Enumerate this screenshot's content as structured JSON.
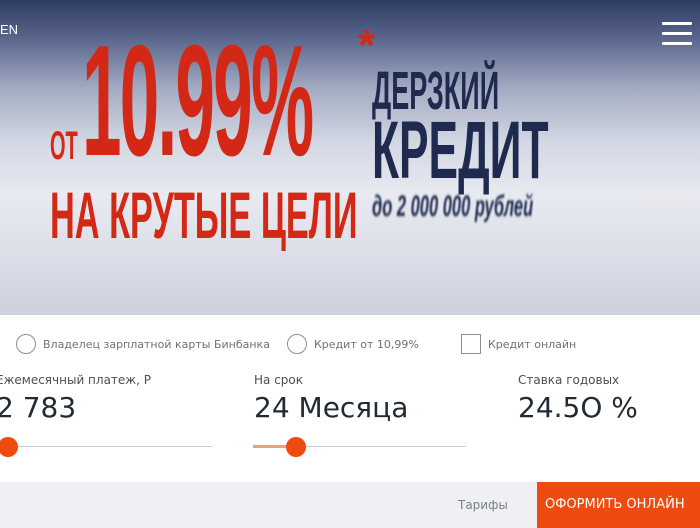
{
  "header": {
    "language": "EN"
  },
  "banner": {
    "rate_prefix": "ОТ",
    "rate_value": "10.99%",
    "rate_asterisk": "*",
    "goal_text": "НА КРУТЫЕ ЦЕЛИ",
    "brand_line1": "ДЕРЗКИЙ",
    "brand_line2": "КРЕДИТ",
    "amount_text": "до 2 000 000 рублей"
  },
  "options": [
    {
      "label": "Владелец зарплатной карты Бинбанка",
      "type": "radio",
      "checked": false
    },
    {
      "label": "Кредит от 10,99%",
      "type": "radio",
      "checked": false
    },
    {
      "label": "Кредит онлайн",
      "type": "checkbox",
      "checked": false
    }
  ],
  "params": {
    "monthly": {
      "label": "Ежемесячный платеж, Р",
      "value": "2 783",
      "slider_fraction": 0.0
    },
    "term": {
      "label": "На срок",
      "value": "24 Месяца",
      "slider_fraction": 0.2
    },
    "rate": {
      "label": "Ставка годовых",
      "value": "24.5O %"
    }
  },
  "footer": {
    "tariffs_label": "Тарифы",
    "cta_label": "ОФОРМИТЬ ОНЛАЙН"
  },
  "colors": {
    "accent": "#ef4a10",
    "banner_red": "#d32816",
    "banner_navy": "#1e2a4e"
  }
}
